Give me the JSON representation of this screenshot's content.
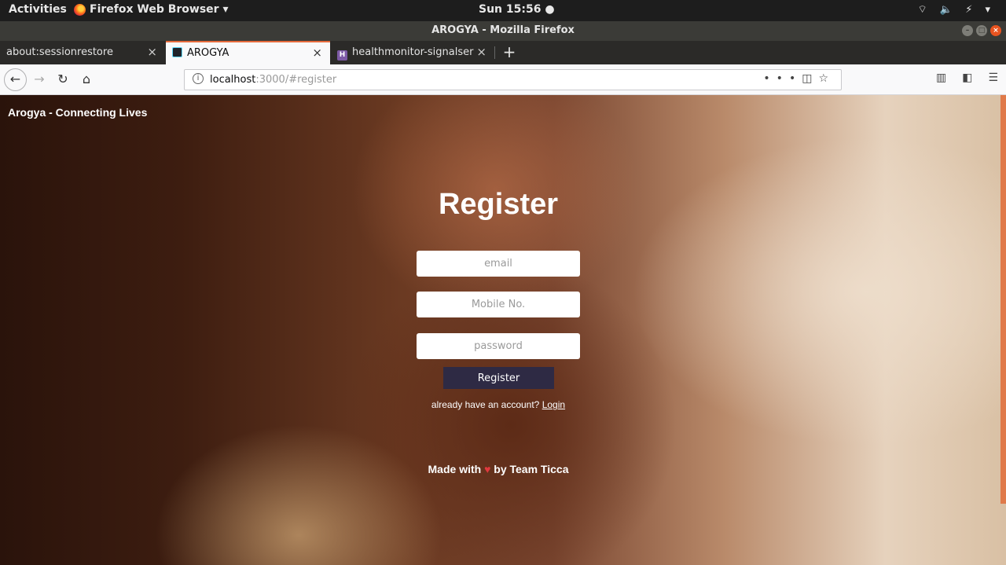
{
  "system_bar": {
    "activities": "Activities",
    "app_menu": "Firefox Web Browser ▾",
    "clock": "Sun 15:56 ●",
    "status_icons": "⌔ 🔈 ⚡ ▾"
  },
  "window": {
    "title": "AROGYA - Mozilla Firefox"
  },
  "tabs": [
    {
      "label": "about:sessionrestore",
      "active": false
    },
    {
      "label": "AROGYA",
      "active": true
    },
    {
      "label": "healthmonitor-signalser",
      "active": false
    }
  ],
  "navbar": {
    "url_host": "localhost",
    "url_rest": ":3000/#register"
  },
  "page": {
    "brand": "Arogya - Connecting Lives",
    "heading": "Register",
    "email_placeholder": "email",
    "mobile_placeholder": "Mobile No.",
    "password_placeholder": "password",
    "register_button": "Register",
    "already_text": "already have an account?",
    "login_link": "Login",
    "footer_before": "Made with",
    "footer_heart": "♥",
    "footer_after": "by Team Ticca"
  }
}
